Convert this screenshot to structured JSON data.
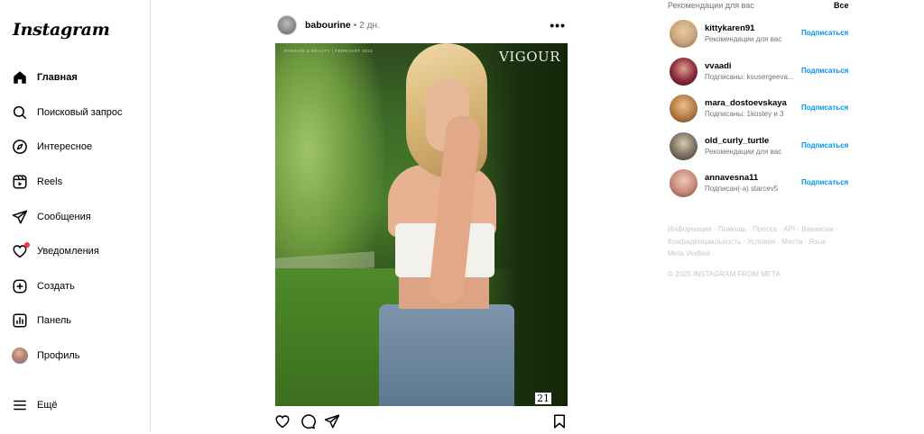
{
  "app": {
    "logo": "Instagram"
  },
  "sidebar": {
    "items": [
      {
        "label": "Главная",
        "icon": "home-icon",
        "active": true
      },
      {
        "label": "Поисковый запрос",
        "icon": "search-icon"
      },
      {
        "label": "Интересное",
        "icon": "compass-icon"
      },
      {
        "label": "Reels",
        "icon": "reels-icon"
      },
      {
        "label": "Сообщения",
        "icon": "paper-plane-icon"
      },
      {
        "label": "Уведомления",
        "icon": "heart-icon",
        "badge": true
      },
      {
        "label": "Создать",
        "icon": "plus-square-icon"
      },
      {
        "label": "Панель",
        "icon": "dashboard-icon"
      },
      {
        "label": "Профиль",
        "icon": "avatar"
      }
    ],
    "more": {
      "label": "Ещё",
      "icon": "hamburger-icon"
    }
  },
  "post": {
    "username": "babourine",
    "separator": "•",
    "time": "2 дн.",
    "more": "•••",
    "image": {
      "magazine": "VIGOUR",
      "magazine_sub": "FASHION & BEAUTY | FEBRUARY 2022",
      "page_number": "21"
    },
    "actions": [
      "heart-icon",
      "comment-icon",
      "share-icon",
      "bookmark-icon"
    ]
  },
  "recommendations": {
    "title": "Рекомендации для вас",
    "see_all": "Все",
    "follow_label": "Подписаться",
    "items": [
      {
        "username": "kittykaren91",
        "subtitle": "Рекомендации для вас",
        "color": "#c9a47c"
      },
      {
        "username": "vvaadi",
        "subtitle": "Подписаны: ksusergeeva...",
        "color": "#8a2a3a"
      },
      {
        "username": "mara_dostoevskaya",
        "subtitle": "Подписаны: 1kostey и 3",
        "color": "#b57a44"
      },
      {
        "username": "old_curly_turtle",
        "subtitle": "Рекомендации для вас",
        "color": "#7a7060"
      },
      {
        "username": "annavesna11",
        "subtitle": "Подписан(-а) starcev5",
        "color": "#c88878"
      }
    ]
  },
  "footer": {
    "links_line1": "Информация · Помощь · Пресса · API · Вакансии ·",
    "links_line2": "Конфиденциальность · Условия · Места · Язык ·",
    "links_line3": "Meta Verified",
    "copyright": "© 2025 INSTAGRAM FROM META"
  },
  "colors": {
    "accent": "#0095f6",
    "muted": "#737373",
    "badge": "#ff3040"
  }
}
